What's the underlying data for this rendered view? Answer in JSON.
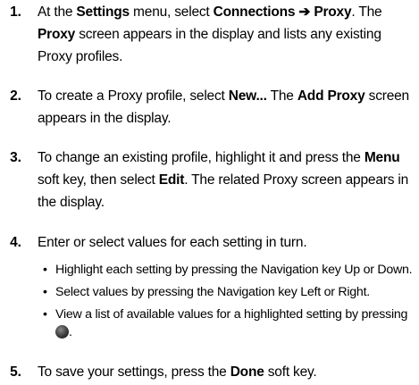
{
  "steps": [
    {
      "num": "1.",
      "parts": [
        [
          "At the ",
          false
        ],
        [
          "Settings",
          true
        ],
        [
          " menu, select ",
          false
        ],
        [
          "Connections ➔ Proxy",
          true
        ],
        [
          ". The ",
          false
        ],
        [
          "Proxy",
          true
        ],
        [
          " screen appears in the display and lists any existing Proxy profiles.",
          false
        ]
      ]
    },
    {
      "num": "2.",
      "parts": [
        [
          "To create a Proxy profile, select ",
          false
        ],
        [
          "New...",
          true
        ],
        [
          " The ",
          false
        ],
        [
          "Add Proxy",
          true
        ],
        [
          " screen appears in the display.",
          false
        ]
      ]
    },
    {
      "num": "3.",
      "parts": [
        [
          "To change an existing profile, highlight it and press the ",
          false
        ],
        [
          "Menu",
          true
        ],
        [
          " soft key, then select ",
          false
        ],
        [
          "Edit",
          true
        ],
        [
          ". The related Proxy screen appears in the display.",
          false
        ]
      ]
    },
    {
      "num": "4.",
      "parts": [
        [
          "Enter or select values for each setting in turn.",
          false
        ]
      ]
    },
    {
      "num": "5.",
      "parts": [
        [
          "To save your settings, press the ",
          false
        ],
        [
          "Done",
          true
        ],
        [
          " soft key.",
          false
        ]
      ]
    }
  ],
  "bullets": [
    "Highlight each setting by pressing the Navigation key Up or Down.",
    "Select values by pressing the Navigation key Left or Right.",
    "View a list of available values for a highlighted setting by pressing"
  ],
  "bullet_glyph": "•",
  "bullet_icon": "navigation-key-center-icon",
  "bullet_icon_suffix": "."
}
